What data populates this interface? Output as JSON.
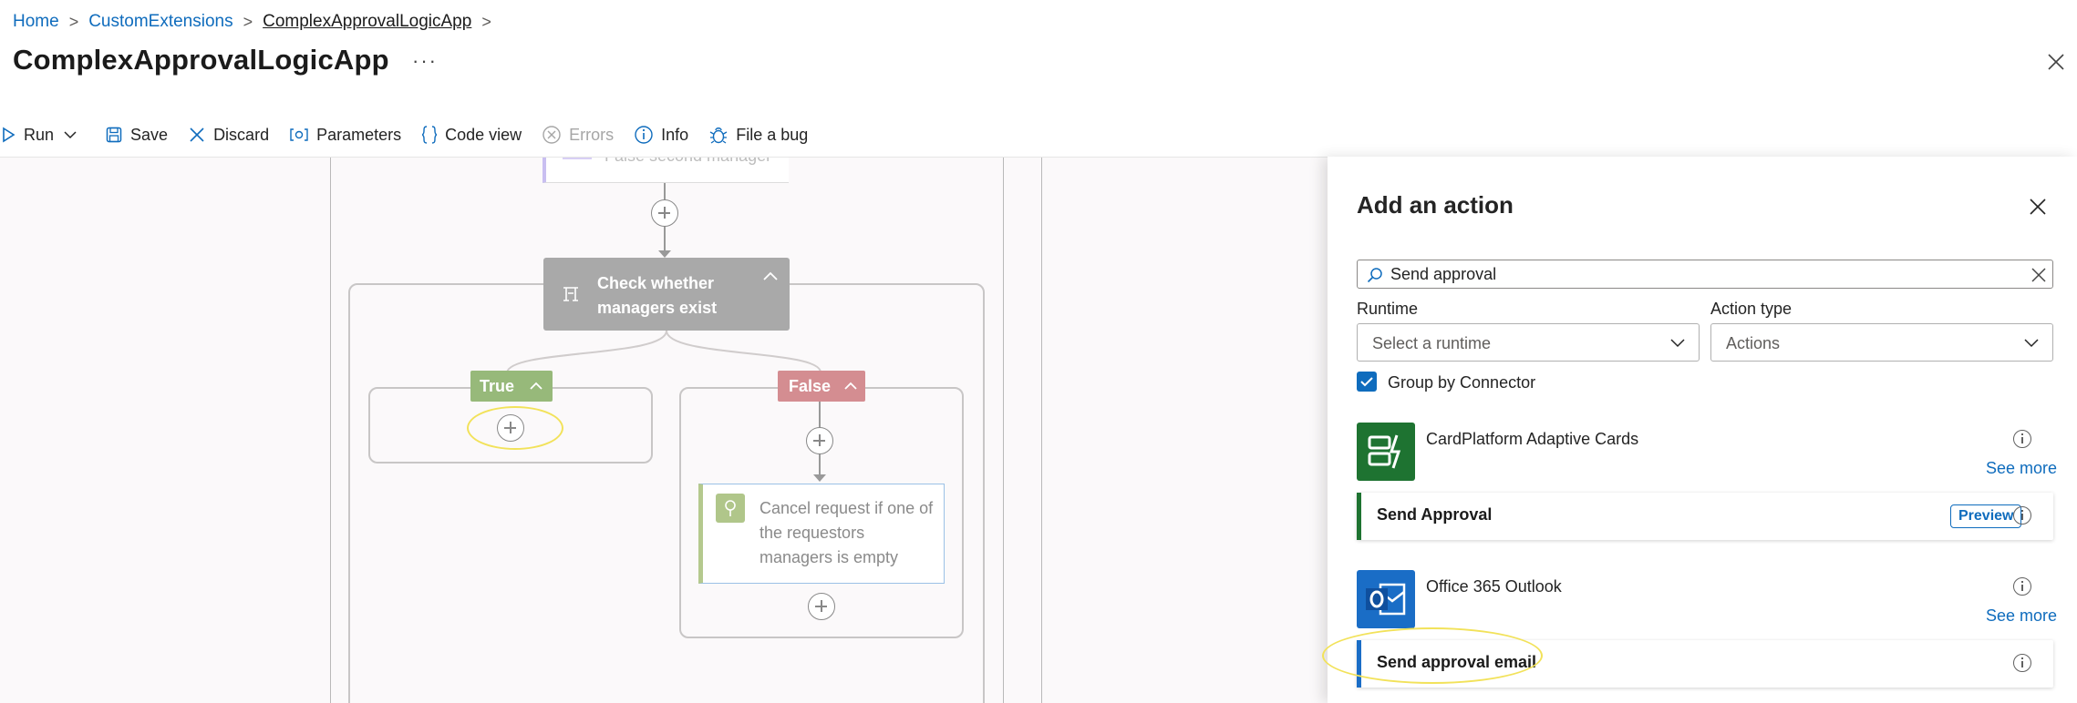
{
  "breadcrumb": {
    "items": [
      {
        "label": "Home"
      },
      {
        "label": "CustomExtensions"
      },
      {
        "label": "ComplexApprovalLogicApp"
      }
    ]
  },
  "header": {
    "title": "ComplexApprovalLogicApp",
    "more": "···"
  },
  "toolbar": {
    "run": "Run",
    "save": "Save",
    "discard": "Discard",
    "parameters": "Parameters",
    "code_view": "Code view",
    "errors": "Errors",
    "info": "Info",
    "file_bug": "File a bug"
  },
  "canvas": {
    "prev_action": "False second manager",
    "condition": "Check whether managers exist",
    "true_branch": "True",
    "false_branch": "False",
    "cancel_action": "Cancel request if one of the requestors managers is empty"
  },
  "panel": {
    "title": "Add an action",
    "search": {
      "value": "Send approval"
    },
    "runtime": {
      "label": "Runtime",
      "placeholder": "Select a runtime"
    },
    "action_type": {
      "label": "Action type",
      "value": "Actions"
    },
    "group_by": {
      "label": "Group by Connector",
      "checked": true
    },
    "connectors": [
      {
        "name": "CardPlatform Adaptive Cards",
        "see_more": "See more",
        "color": "#1e7331",
        "action": {
          "label": "Send Approval",
          "badge": "Preview"
        }
      },
      {
        "name": "Office 365 Outlook",
        "see_more": "See more",
        "color": "#1a6dc6",
        "action": {
          "label": "Send approval email"
        }
      }
    ]
  },
  "colors": {
    "link": "#0f6cbd",
    "true_branch": "#97b97a",
    "false_branch": "#d48d91",
    "condition_card": "#a9a9a9",
    "highlight": "#f2e25a"
  }
}
